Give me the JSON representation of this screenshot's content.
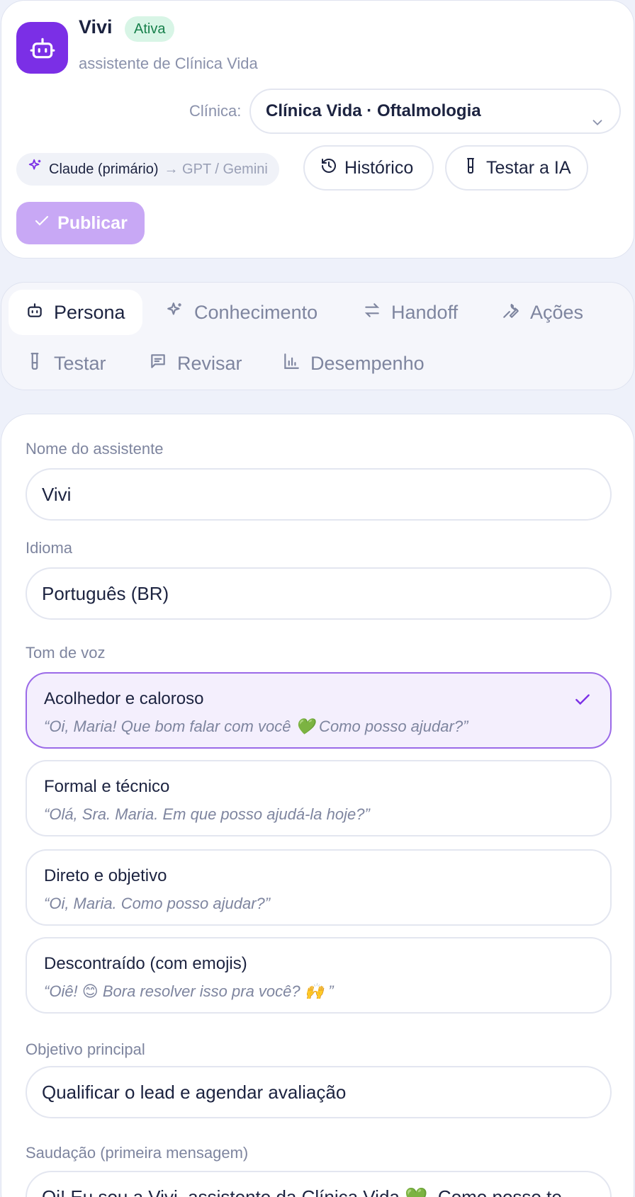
{
  "header": {
    "agent_name": "Vivi",
    "status": "Ativa",
    "subtitle": "assistente de Clínica Vida",
    "clinic_label": "Clínica:",
    "clinic_selected": "Clínica Vida · Oftalmologia",
    "model_primary": "Claude (primário)",
    "model_fallback": "→ GPT / Gemini",
    "history_label": "Histórico",
    "test_ai_label": "Testar a IA",
    "publish_label": "Publicar",
    "avatar_icon": "robot-icon"
  },
  "tabs": [
    {
      "label": "Persona",
      "icon": "robot-icon",
      "active": true
    },
    {
      "label": "Conhecimento",
      "icon": "sparkles-icon",
      "active": false
    },
    {
      "label": "Handoff",
      "icon": "arrows-swap-icon",
      "active": false
    },
    {
      "label": "Ações",
      "icon": "wrench-icon",
      "active": false
    },
    {
      "label": "Testar",
      "icon": "beaker-icon",
      "active": false
    },
    {
      "label": "Revisar",
      "icon": "message-icon",
      "active": false
    },
    {
      "label": "Desempenho",
      "icon": "bar-chart-icon",
      "active": false
    }
  ],
  "form": {
    "name_label": "Nome do assistente",
    "name_value": "Vivi",
    "language_label": "Idioma",
    "language_value": "Português (BR)",
    "tone_label": "Tom de voz",
    "tones": [
      {
        "title": "Acolhedor e caloroso",
        "example": "“Oi, Maria! Que bom falar com você 💚  Como posso ajudar?”",
        "selected": true
      },
      {
        "title": "Formal e técnico",
        "example": "“Olá, Sra. Maria. Em que posso ajudá-la hoje?”",
        "selected": false
      },
      {
        "title": "Direto e objetivo",
        "example": "“Oi, Maria. Como posso ajudar?”",
        "selected": false
      },
      {
        "title": "Descontraído (com emojis)",
        "example": "“Oiê! 😊  Bora resolver isso pra você? 🙌 ”",
        "selected": false
      }
    ],
    "goal_label": "Objetivo principal",
    "goal_value": "Qualificar o lead e agendar avaliação",
    "greeting_label": "Saudação (primeira mensagem)",
    "greeting_value": "Oi! Eu sou a Vivi, assistente da Clínica Vida 💚. Como posso te"
  },
  "colors": {
    "accent": "#7b2fe6",
    "publish_disabled": "#c8a8f5",
    "status_bg": "#d8f5e6",
    "status_text": "#17804b",
    "page_bg": "#eef1fa"
  }
}
